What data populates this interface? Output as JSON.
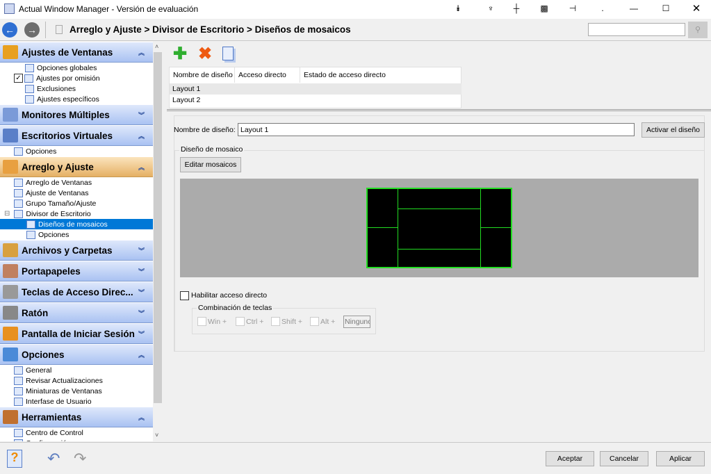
{
  "window": {
    "title": "Actual Window Manager - Versión de evaluación",
    "title_icons": [
      "collapse-icon",
      "wrench-icon",
      "pin-icon",
      "grid-icon",
      "pushpin-icon",
      "dot-icon"
    ],
    "controls": [
      "minimize",
      "maximize",
      "close"
    ]
  },
  "nav": {
    "breadcrumb": "Arreglo y Ajuste > Divisor de Escritorio > Diseños de mosaicos",
    "search_value": ""
  },
  "sidebar": {
    "groups": [
      {
        "label": "Ajustes de Ventanas",
        "expanded": true,
        "items": [
          {
            "label": "Opciones globales"
          },
          {
            "label": "Ajustes por omisión",
            "checked": true
          },
          {
            "label": "Exclusiones"
          },
          {
            "label": "Ajustes específicos"
          }
        ]
      },
      {
        "label": "Monitores Múltiples",
        "expanded": false,
        "items": []
      },
      {
        "label": "Escritorios Virtuales",
        "expanded": true,
        "items": [
          {
            "label": "Opciones"
          }
        ]
      },
      {
        "label": "Arreglo y Ajuste",
        "expanded": true,
        "active": true,
        "items": [
          {
            "label": "Arreglo de Ventanas"
          },
          {
            "label": "Ajuste de Ventanas"
          },
          {
            "label": "Grupo Tamaño/Ajuste"
          },
          {
            "label": "Divisor de Escritorio"
          },
          {
            "label": "Diseños de mosaicos",
            "selected": true
          },
          {
            "label": "Opciones"
          }
        ]
      },
      {
        "label": "Archivos y Carpetas",
        "expanded": false,
        "items": []
      },
      {
        "label": "Portapapeles",
        "expanded": false,
        "items": []
      },
      {
        "label": "Teclas de Acceso Direc...",
        "expanded": false,
        "items": []
      },
      {
        "label": "Ratón",
        "expanded": false,
        "items": []
      },
      {
        "label": "Pantalla de Iniciar Sesión",
        "expanded": false,
        "items": []
      },
      {
        "label": "Opciones",
        "expanded": true,
        "items": [
          {
            "label": "General"
          },
          {
            "label": "Revisar Actualizaciones"
          },
          {
            "label": "Miniaturas de Ventanas"
          },
          {
            "label": "Interfase de Usuario"
          }
        ]
      },
      {
        "label": "Herramientas",
        "expanded": true,
        "items": [
          {
            "label": "Centro de Control"
          },
          {
            "label": "Configuración..."
          }
        ]
      }
    ]
  },
  "toolbar": {
    "add": "add-icon",
    "delete": "delete-icon",
    "copy": "copy-icon"
  },
  "table": {
    "columns": [
      "Nombre de diseño",
      "Acceso directo",
      "Estado de acceso directo"
    ],
    "rows": [
      [
        "Layout 1",
        "",
        ""
      ],
      [
        "Layout 2",
        "",
        ""
      ]
    ]
  },
  "form": {
    "name_label": "Nombre de diseño:",
    "name_value": "Layout 1",
    "activate_label": "Activar el diseño",
    "group_label": "Diseño de mosaico",
    "edit_label": "Editar mosaicos",
    "hotkey_enable_label": "Habilitar acceso directo",
    "hotkey_enabled": false,
    "combo_label": "Combinación de teclas",
    "mods": [
      "Win +",
      "Ctrl +",
      "Shift +",
      "Alt +"
    ],
    "key_value": "Ninguno"
  },
  "colors": {
    "tile_border": "#22dd22",
    "selection": "#0078d7"
  },
  "bottom": {
    "ok": "Aceptar",
    "cancel": "Cancelar",
    "apply": "Aplicar"
  }
}
